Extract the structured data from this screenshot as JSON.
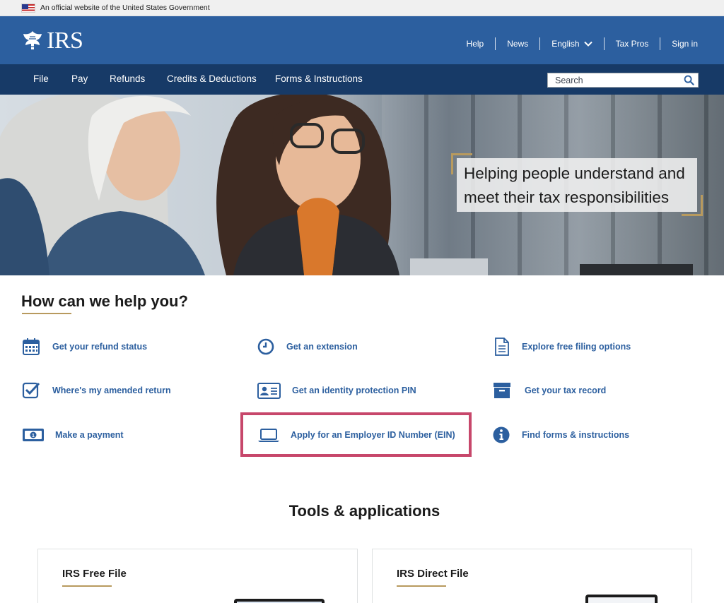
{
  "gov_banner": {
    "text": "An official website of the United States Government",
    "flag_icon": "us-flag-icon"
  },
  "header": {
    "logo_text": "IRS",
    "logo_icon": "irs-eagle-logo-icon",
    "utility_nav": [
      {
        "label": "Help"
      },
      {
        "label": "News"
      },
      {
        "label": "English",
        "icon": "chevron-down-icon"
      },
      {
        "label": "Tax Pros"
      },
      {
        "label": "Sign in"
      }
    ]
  },
  "main_nav": {
    "items": [
      {
        "label": "File"
      },
      {
        "label": "Pay"
      },
      {
        "label": "Refunds"
      },
      {
        "label": "Credits & Deductions"
      },
      {
        "label": "Forms & Instructions"
      }
    ],
    "search": {
      "placeholder": "Search",
      "value": "",
      "icon": "search-icon"
    }
  },
  "hero": {
    "caption": "Helping people understand and meet their tax responsibilities"
  },
  "help_section": {
    "heading": "How can we help you?",
    "links": [
      {
        "label": "Get your refund status",
        "icon": "calendar-icon"
      },
      {
        "label": "Get an extension",
        "icon": "clock-icon"
      },
      {
        "label": "Explore free filing options",
        "icon": "document-icon"
      },
      {
        "label": "Where's my amended return",
        "icon": "checkbox-checked-icon"
      },
      {
        "label": "Get an identity protection PIN",
        "icon": "id-card-icon"
      },
      {
        "label": "Get your tax record",
        "icon": "archive-box-icon"
      },
      {
        "label": "Make a payment",
        "icon": "money-bill-icon"
      },
      {
        "label": "Apply for an Employer ID Number (EIN)",
        "icon": "laptop-icon",
        "highlighted": true
      },
      {
        "label": "Find forms & instructions",
        "icon": "info-icon"
      }
    ]
  },
  "tools_section": {
    "heading": "Tools & applications",
    "cards": [
      {
        "title": "IRS Free File",
        "icon": "laptop-illustration-icon"
      },
      {
        "title": "IRS Direct File",
        "icon": "tablet-illustration-icon"
      }
    ]
  },
  "colors": {
    "header_blue": "#2c5f9f",
    "nav_dark_blue": "#173a67",
    "link_blue": "#2c5f9f",
    "accent_gold": "#b89a5e",
    "highlight_pink": "#c7476b"
  }
}
